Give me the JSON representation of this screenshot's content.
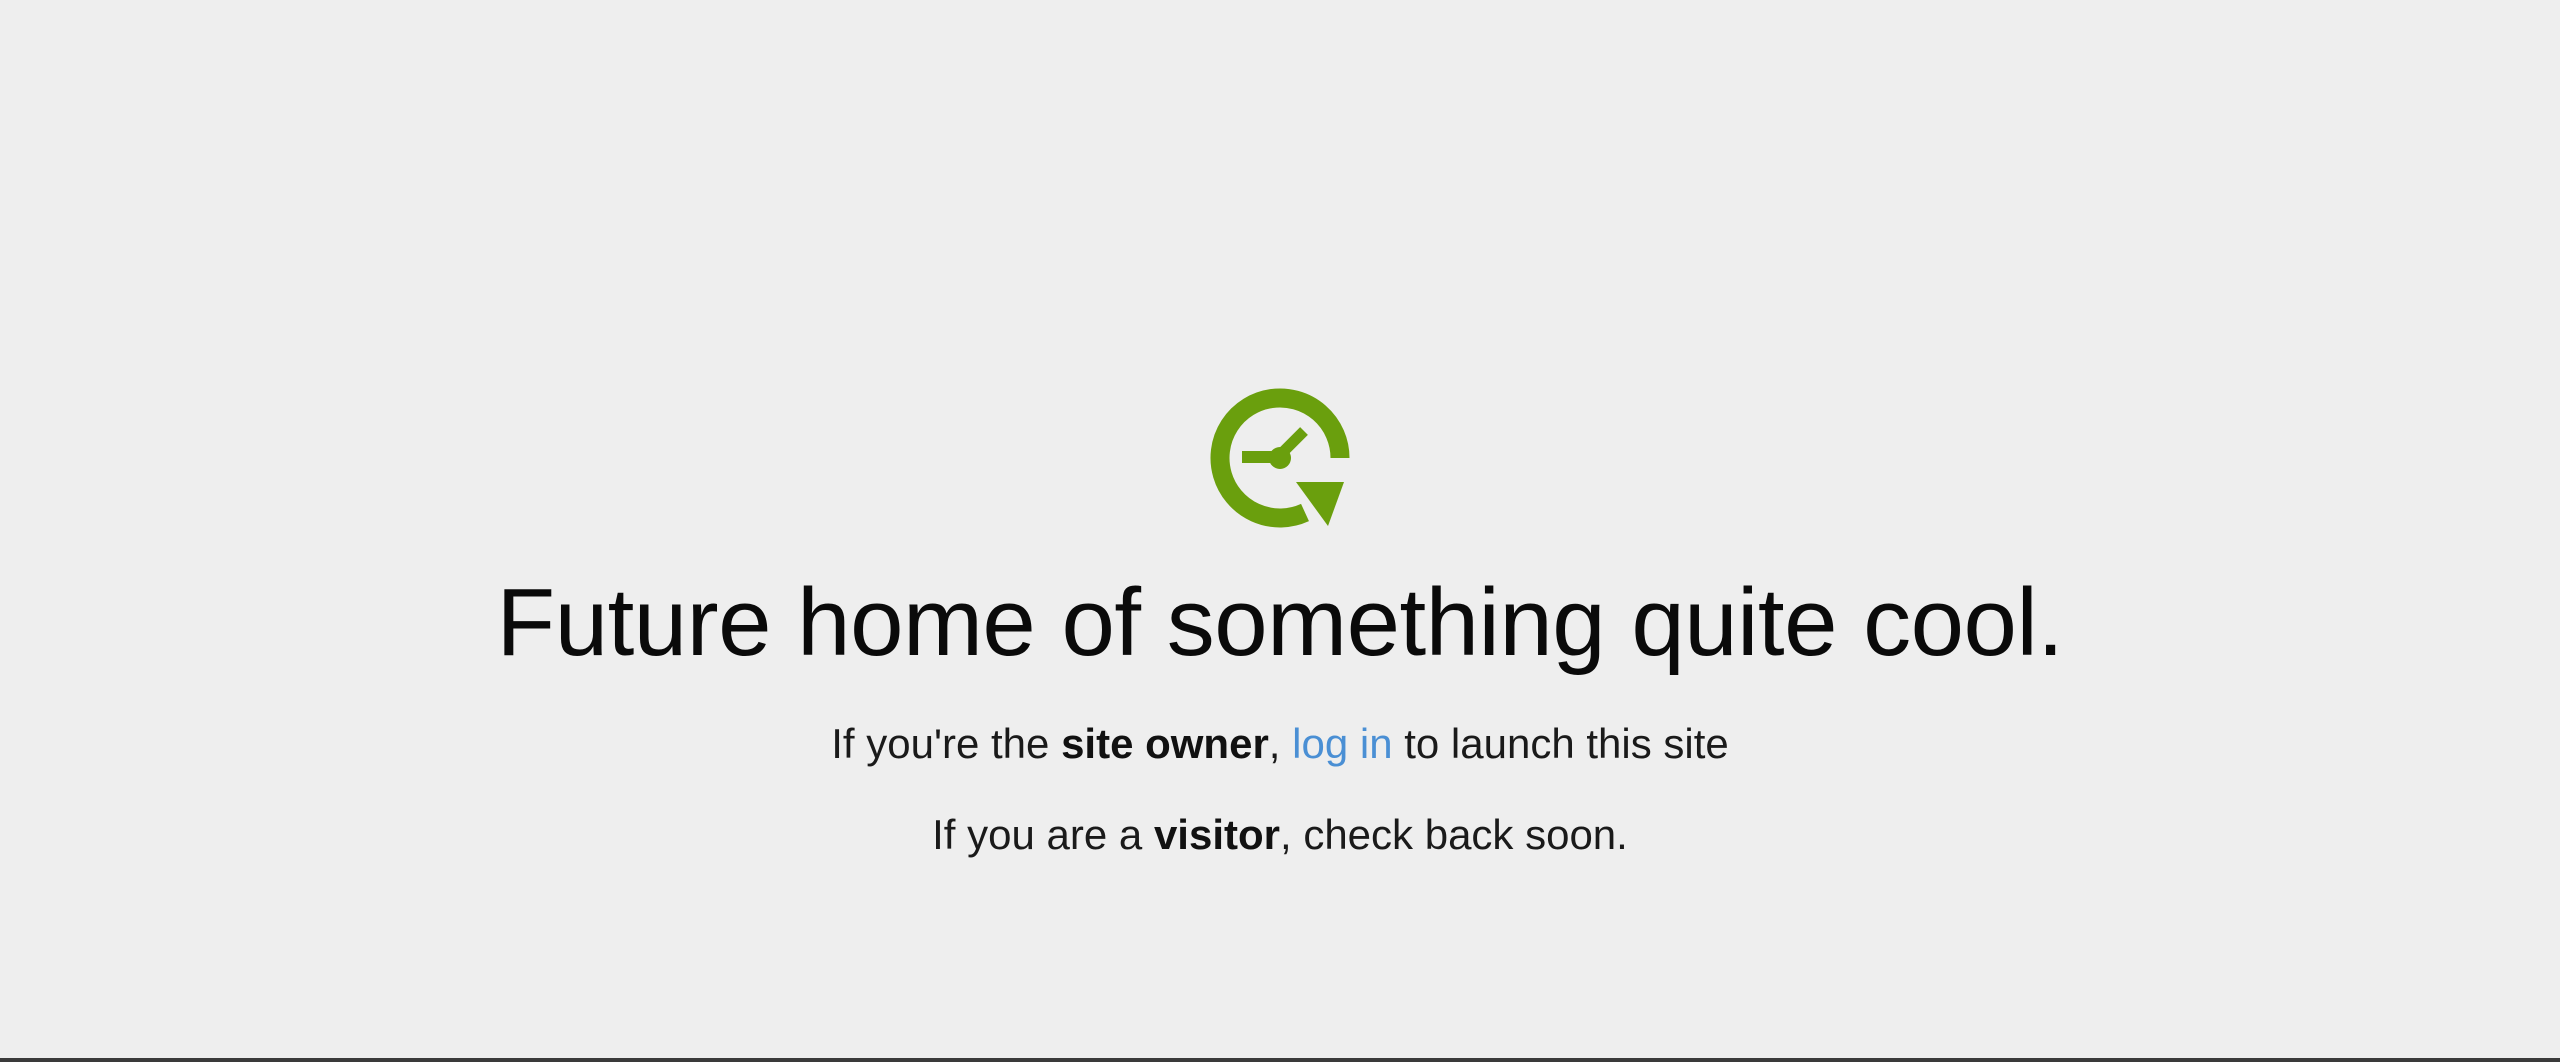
{
  "colors": {
    "background": "#eeeeee",
    "logo_green": "#6a9f0d",
    "link_blue": "#4a8fd4",
    "text": "#111111"
  },
  "logo": {
    "icon": "clock-refresh-icon"
  },
  "headline": "Future home of something quite cool.",
  "owner_line": {
    "prefix": "If you're the ",
    "bold": "site owner",
    "comma": ", ",
    "link": "log in",
    "suffix": " to launch this site"
  },
  "visitor_line": {
    "prefix": "If you are a ",
    "bold": "visitor",
    "suffix": ", check back soon."
  }
}
